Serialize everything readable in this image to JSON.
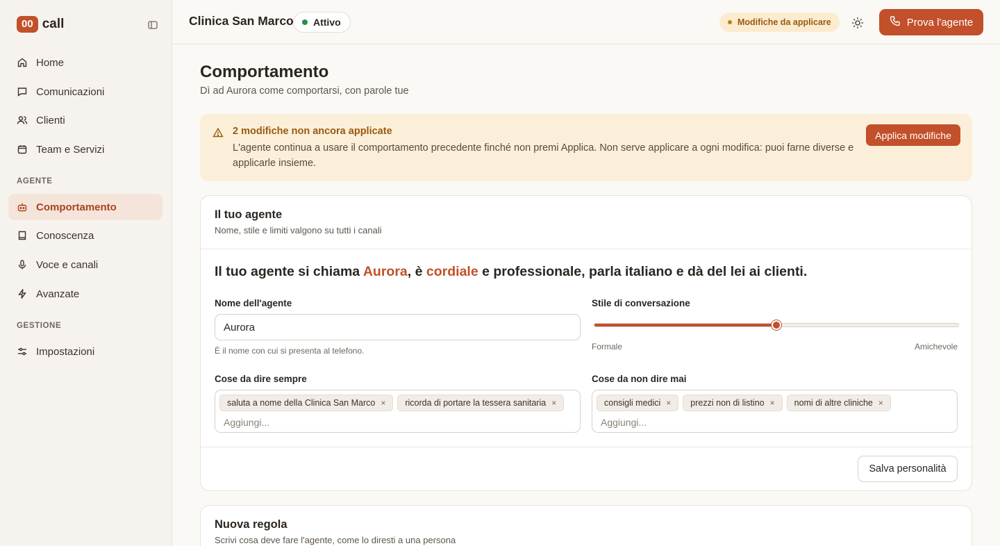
{
  "logo": {
    "badge": "00",
    "text": "call"
  },
  "sidebar": {
    "items": [
      {
        "label": "Home",
        "icon": "home-icon"
      },
      {
        "label": "Comunicazioni",
        "icon": "chat-icon"
      },
      {
        "label": "Clienti",
        "icon": "users-icon"
      },
      {
        "label": "Team e Servizi",
        "icon": "calendar-icon"
      }
    ],
    "section_agent": "AGENTE",
    "agent_items": [
      {
        "label": "Comportamento",
        "icon": "bot-icon",
        "active": true
      },
      {
        "label": "Conoscenza",
        "icon": "book-icon"
      },
      {
        "label": "Voce e canali",
        "icon": "microphone-icon"
      },
      {
        "label": "Avanzate",
        "icon": "bolt-icon"
      }
    ],
    "section_manage": "GESTIONE",
    "manage_items": [
      {
        "label": "Impostazioni",
        "icon": "sliders-icon"
      }
    ]
  },
  "header": {
    "clinic_name": "Clinica San Marco",
    "status": "Attivo",
    "pending": "Modifiche da applicare",
    "try_agent": "Prova l'agente"
  },
  "page": {
    "title": "Comportamento",
    "subtitle": "Dì ad Aurora come comportarsi, con parole tue"
  },
  "banner": {
    "title": "2 modifiche non ancora applicate",
    "text": "L'agente continua a usare il comportamento precedente finché non premi Applica. Non serve applicare a ogni modifica: puoi farne diverse e applicarle insieme.",
    "apply": "Applica modifiche"
  },
  "agent_card": {
    "title": "Il tuo agente",
    "subtitle": "Nome, stile e limiti valgono su tutti i canali",
    "sentence_1": "Il tuo agente si chiama ",
    "sentence_name": "Aurora",
    "sentence_2": ", è ",
    "sentence_style": "cordiale",
    "sentence_3": " e professionale, parla italiano e dà del lei ai clienti.",
    "name_label": "Nome dell'agente",
    "name_value": "Aurora",
    "name_hint": "È il nome con cui si presenta al telefono.",
    "style_label": "Stile di conversazione",
    "style_value": 0.5,
    "style_min": "Formale",
    "style_max": "Amichevole",
    "always_label": "Cose da dire sempre",
    "always_tags": [
      "saluta a nome della Clinica San Marco",
      "ricorda di portare la tessera sanitaria"
    ],
    "never_label": "Cose da non dire mai",
    "never_tags": [
      "consigli medici",
      "prezzi non di listino",
      "nomi di altre cliniche"
    ],
    "add_placeholder": "Aggiungi...",
    "save": "Salva personalità"
  },
  "rule_card": {
    "title": "Nuova regola",
    "subtitle": "Scrivi cosa deve fare l'agente, come lo diresti a una persona"
  },
  "colors": {
    "accent": "#c2502a",
    "pending": "#9a5a10",
    "active_dot": "#2e8b4a"
  }
}
